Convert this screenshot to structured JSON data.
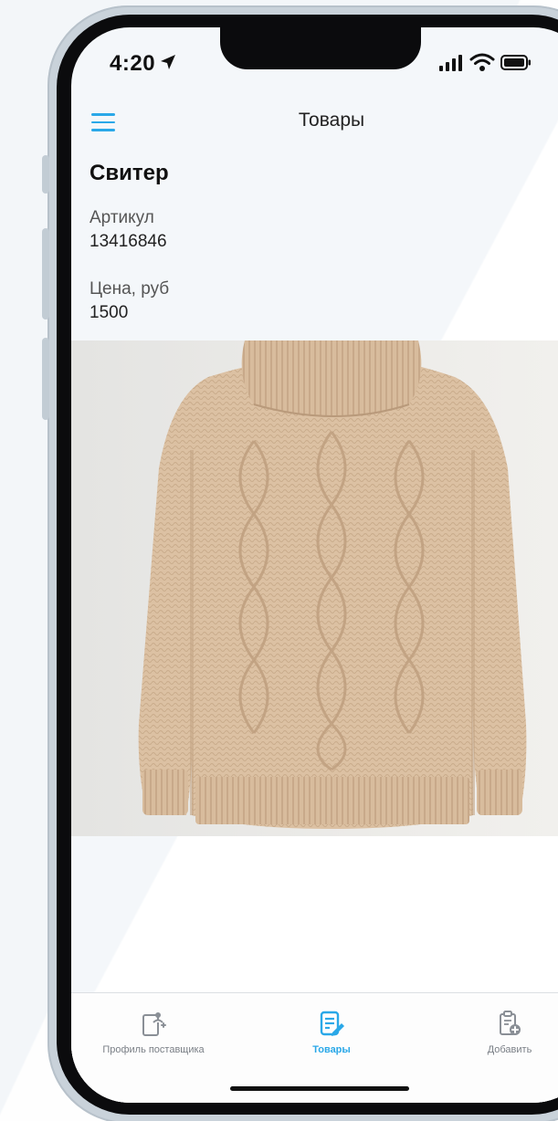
{
  "status_bar": {
    "time": "4:20"
  },
  "app_bar": {
    "title": "Товары"
  },
  "product": {
    "name": "Свитер",
    "article_label": "Артикул",
    "article_value": "13416846",
    "price_label": "Цена, руб",
    "price_value": "1500"
  },
  "tab_bar": {
    "tabs": [
      {
        "label": "Профиль поставщика",
        "icon": "supplier-profile-icon",
        "active": false
      },
      {
        "label": "Товары",
        "icon": "products-edit-icon",
        "active": true
      },
      {
        "label": "Добавить",
        "icon": "add-clipboard-icon",
        "active": false
      }
    ]
  },
  "colors": {
    "accent": "#2aa8e8",
    "inactive": "#7a7f86",
    "frame": "#0b0b0d",
    "screen_background": "#f4f7fa"
  }
}
